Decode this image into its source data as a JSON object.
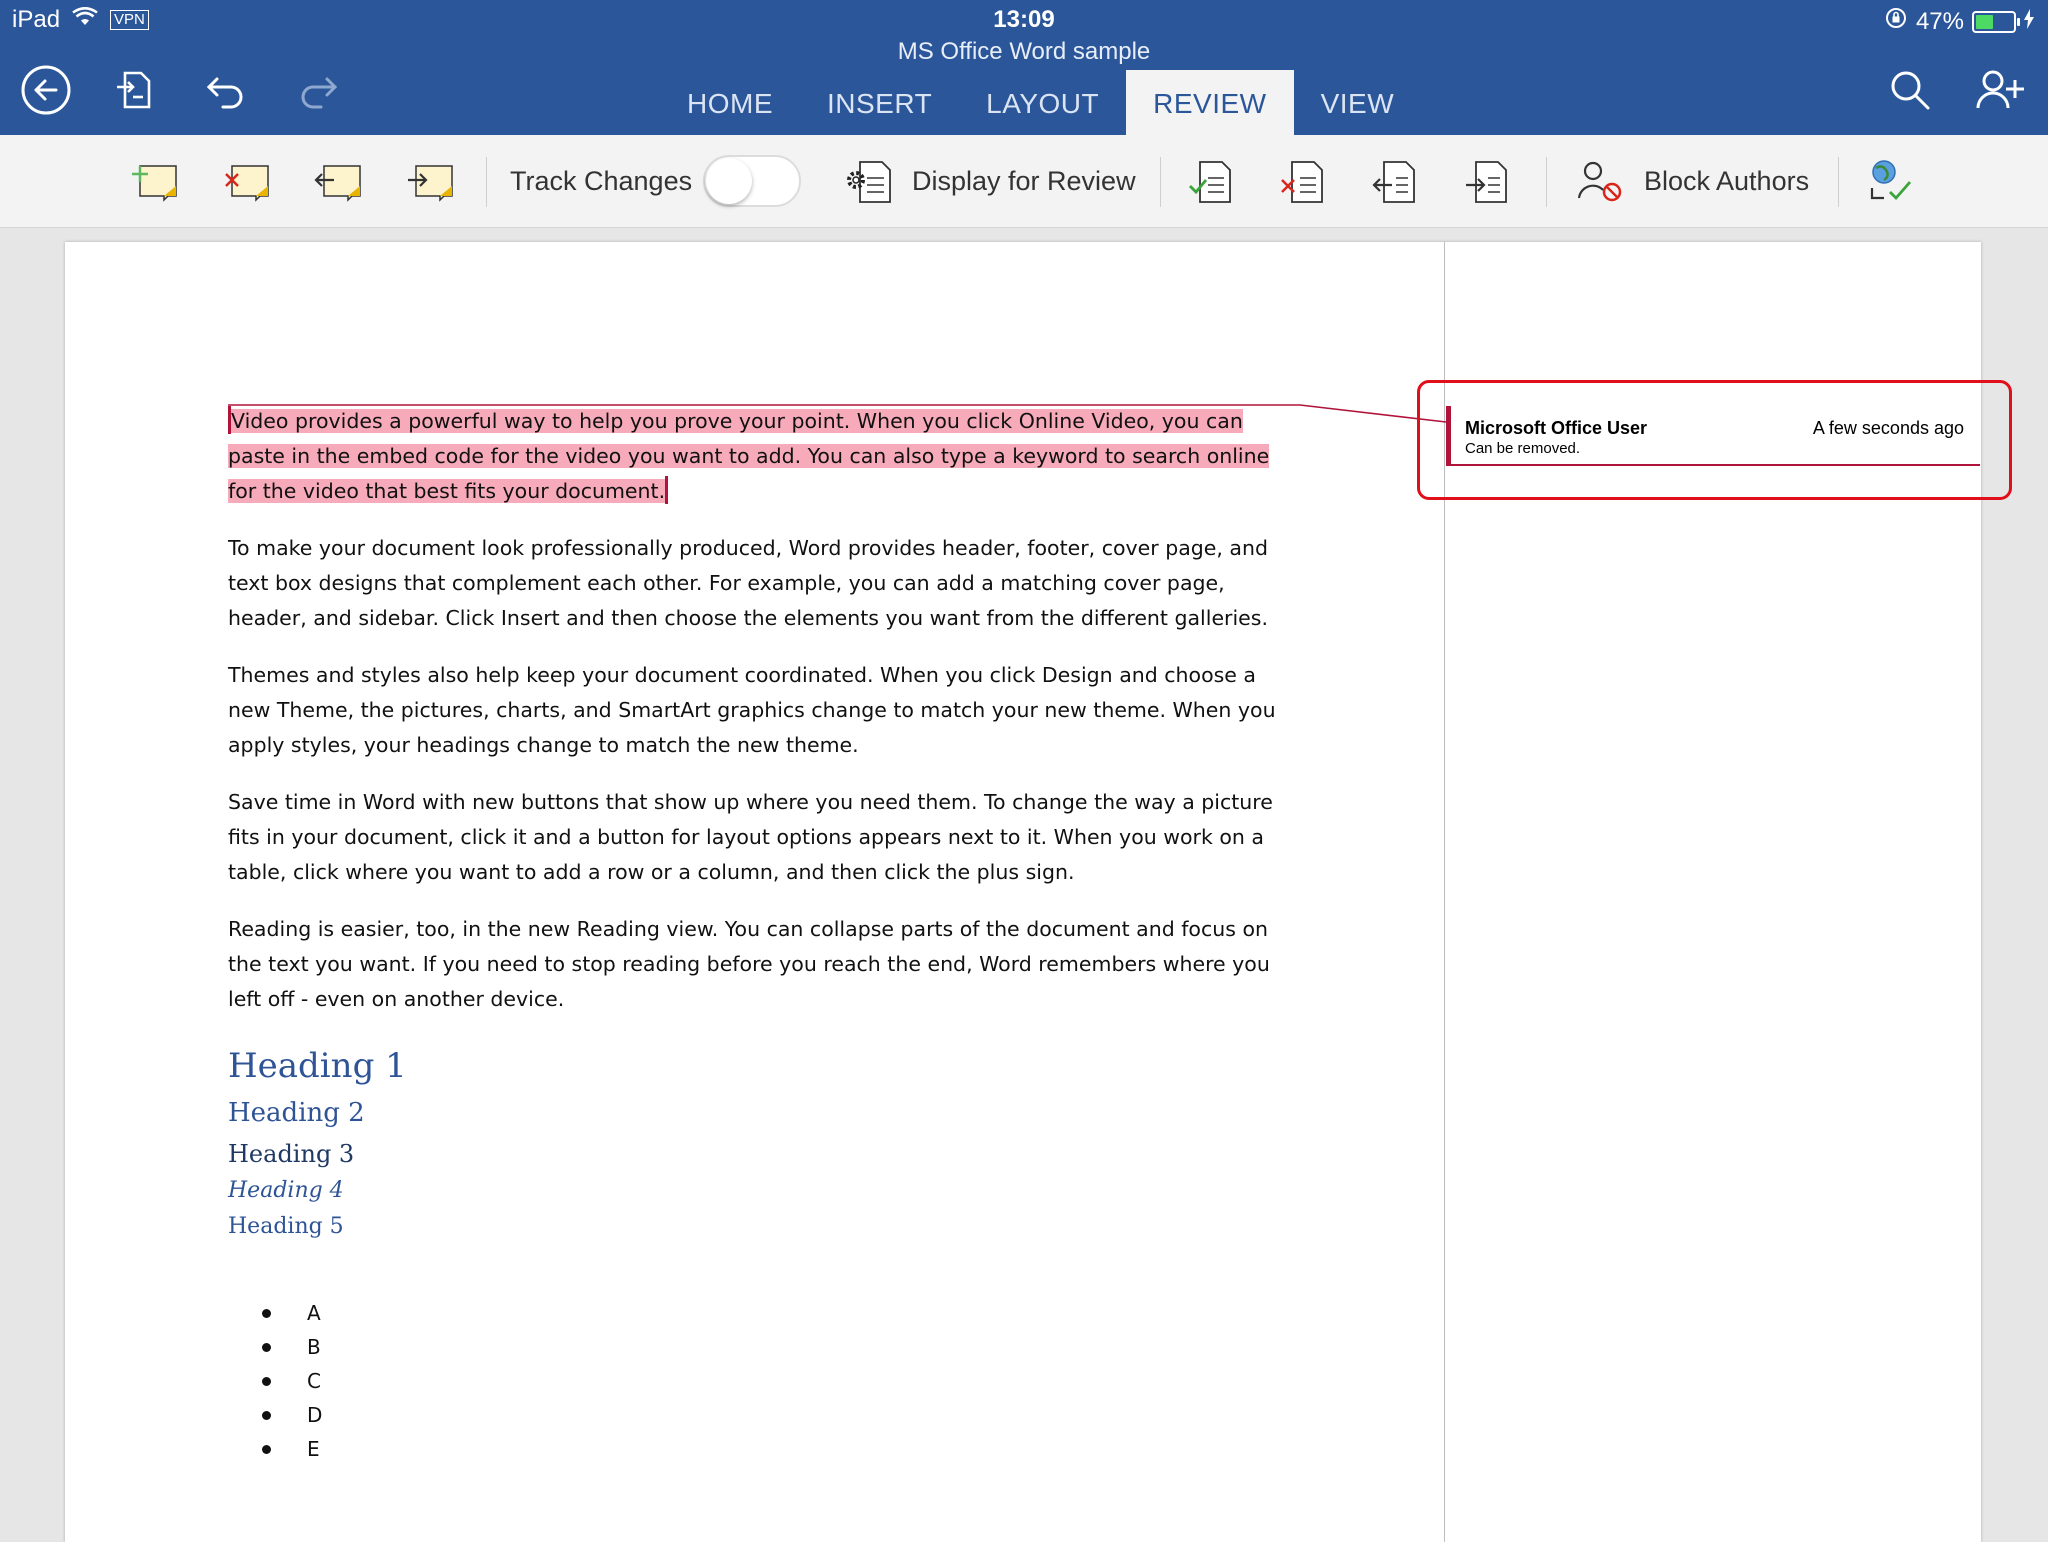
{
  "status_bar": {
    "device": "iPad",
    "vpn": "VPN",
    "time": "13:09",
    "battery": "47%",
    "battery_level": 0.47
  },
  "app": {
    "document_title": "MS Office Word sample"
  },
  "tabs": [
    {
      "label": "HOME",
      "active": false
    },
    {
      "label": "INSERT",
      "active": false
    },
    {
      "label": "LAYOUT",
      "active": false
    },
    {
      "label": "REVIEW",
      "active": true
    },
    {
      "label": "VIEW",
      "active": false
    }
  ],
  "ribbon": {
    "track_changes_label": "Track Changes",
    "track_changes_on": false,
    "display_for_review_label": "Display for Review",
    "block_authors_label": "Block Authors"
  },
  "document": {
    "paragraphs": [
      "Video provides a powerful way to help you prove your point. When you click Online Video, you can paste in the embed code for the video you want to add. You can also type a keyword to search online for the video that best fits your document.",
      "To make your document look professionally produced, Word provides header, footer, cover page, and text box designs that complement each other. For example, you can add a matching cover page, header, and sidebar. Click Insert and then choose the elements you want from the different galleries.",
      "Themes and styles also help keep your document coordinated. When you click Design and choose a new Theme, the pictures, charts, and SmartArt graphics change to match your new theme. When you apply styles, your headings change to match the new theme.",
      "Save time in Word with new buttons that show up where you need them. To change the way a picture fits in your document, click it and a button for layout options appears next to it. When you work on a table, click where you want to add a row or a column, and then click the plus sign.",
      "Reading is easier, too, in the new Reading view. You can collapse parts of the document and focus on the text you want. If you need to stop reading before you reach the end, Word remembers where you left off - even on another device."
    ],
    "headings": [
      "Heading 1",
      "Heading 2",
      "Heading 3",
      "Heading 4",
      "Heading 5"
    ],
    "bullets": [
      "A",
      "B",
      "C",
      "D",
      "E"
    ]
  },
  "comment": {
    "author": "Microsoft Office User",
    "time": "A few seconds ago",
    "text": "Can be removed."
  },
  "colors": {
    "brand_blue": "#2b579a",
    "highlight": "#f7aab9",
    "comment_accent": "#b0143a",
    "annotation_box": "#e0101a"
  }
}
